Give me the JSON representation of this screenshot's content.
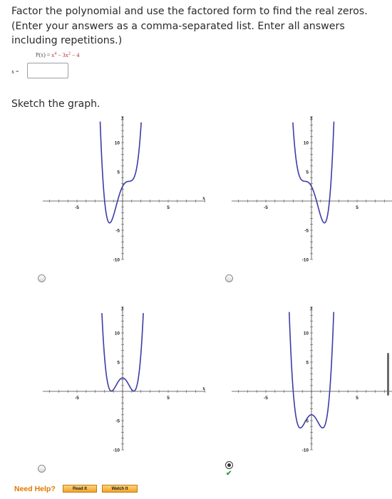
{
  "question": {
    "text": "Factor the polynomial and use the factored form to find the real zeros. (Enter your answers as a comma-separated list. Enter all answers including repetitions.)",
    "formula_lhs": "P(x) = ",
    "formula_rhs": "x",
    "formula_exp1": "4",
    "formula_mid": " − 3x",
    "formula_exp2": "2",
    "formula_tail": " − 4",
    "answer_label": "x =",
    "answer_value": ""
  },
  "sketch": {
    "label": "Sketch the graph.",
    "selected_option": 4,
    "graphs": [
      {
        "id": 1,
        "function": "p1",
        "tick_labels": {
          "x_neg": "-5",
          "x_pos": "5",
          "y10": "10",
          "y5": "5",
          "y_5": "-5",
          "y_10": "-10"
        },
        "x_axis_label": "x",
        "y_axis_label": "y"
      },
      {
        "id": 2,
        "function": "p2",
        "tick_labels": {
          "x_neg": "-5",
          "x_pos": "5",
          "y10": "10",
          "y5": "5",
          "y_5": "-5",
          "y_10": "-10"
        },
        "x_axis_label": "",
        "y_axis_label": "y"
      },
      {
        "id": 3,
        "function": "p3",
        "tick_labels": {
          "x_neg": "-5",
          "x_pos": "5",
          "y10": "10",
          "y5": "5",
          "y_5": "-5",
          "y_10": "-10"
        },
        "x_axis_label": "x",
        "y_axis_label": "y"
      },
      {
        "id": 4,
        "function": "p4",
        "tick_labels": {
          "x_neg": "-5",
          "x_pos": "5",
          "y10": "10",
          "y5": "5",
          "y_5": "-5",
          "y_10": "-10"
        },
        "x_axis_label": "",
        "y_axis_label": "y"
      }
    ],
    "curve_color": "#3c3ca8",
    "correct_mark": "✔"
  },
  "help": {
    "label": "Need Help?",
    "read_it": "Read It",
    "watch_it": "Watch It"
  }
}
